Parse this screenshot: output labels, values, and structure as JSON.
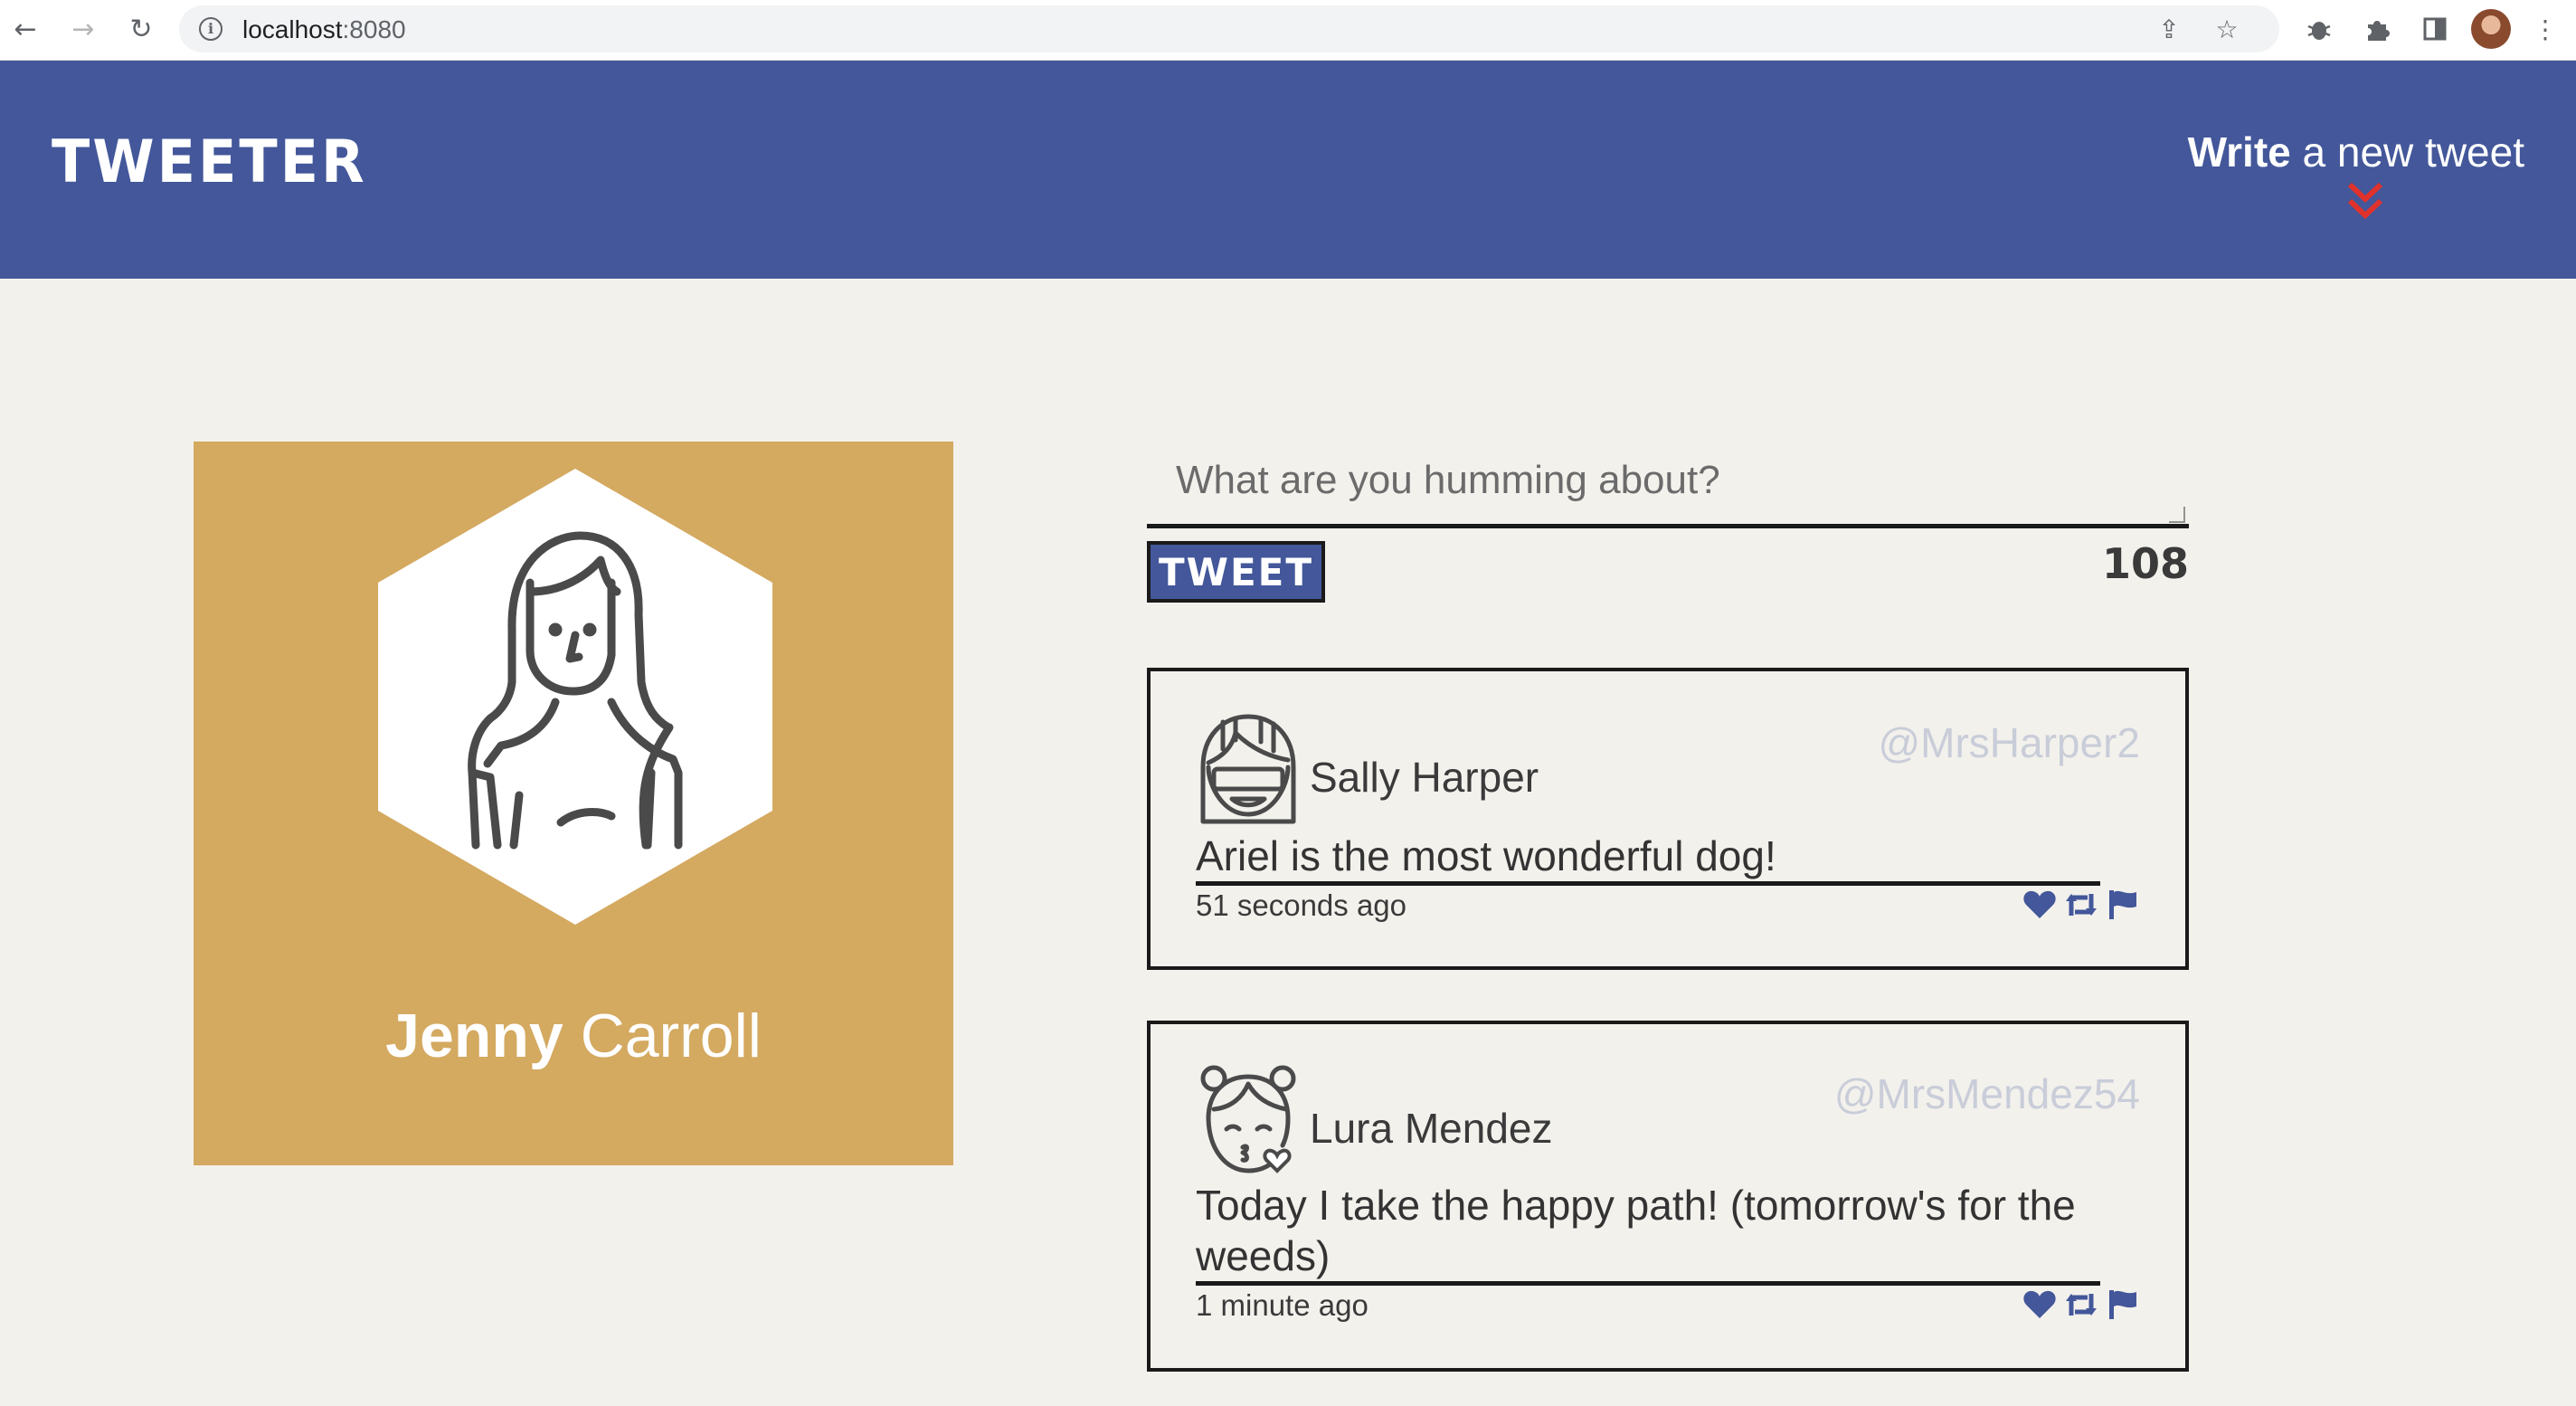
{
  "browser": {
    "url_host": "localhost",
    "url_port": ":8080",
    "icons": [
      "back-icon",
      "forward-icon",
      "reload-icon",
      "info-icon",
      "share-icon",
      "star-icon",
      "bug-icon",
      "puzzle-icon",
      "sidepanel-icon",
      "profile-avatar",
      "menu-icon"
    ]
  },
  "header": {
    "logo": "TWEETER",
    "write_bold": "Write",
    "write_rest": " a new tweet",
    "accent": "#43579a",
    "chevron_color": "#e0322b"
  },
  "profile": {
    "first_name": "Jenny",
    "last_name": "Carroll",
    "card_color": "#d4a960"
  },
  "compose": {
    "placeholder": "What are you humming about?",
    "button_label": "TWEET",
    "counter": "108"
  },
  "tweets": [
    {
      "name": "Sally Harper",
      "handle": "@MrsHarper2",
      "text": "Ariel is the most wonderful dog!",
      "time": "51 seconds ago",
      "actions": [
        "heart-icon",
        "retweet-icon",
        "flag-icon"
      ]
    },
    {
      "name": "Lura Mendez",
      "handle": "@MrsMendez54",
      "text": "Today I take the happy path! (tomorrow's for the weeds)",
      "time": "1 minute ago",
      "actions": [
        "heart-icon",
        "retweet-icon",
        "flag-icon"
      ]
    }
  ]
}
